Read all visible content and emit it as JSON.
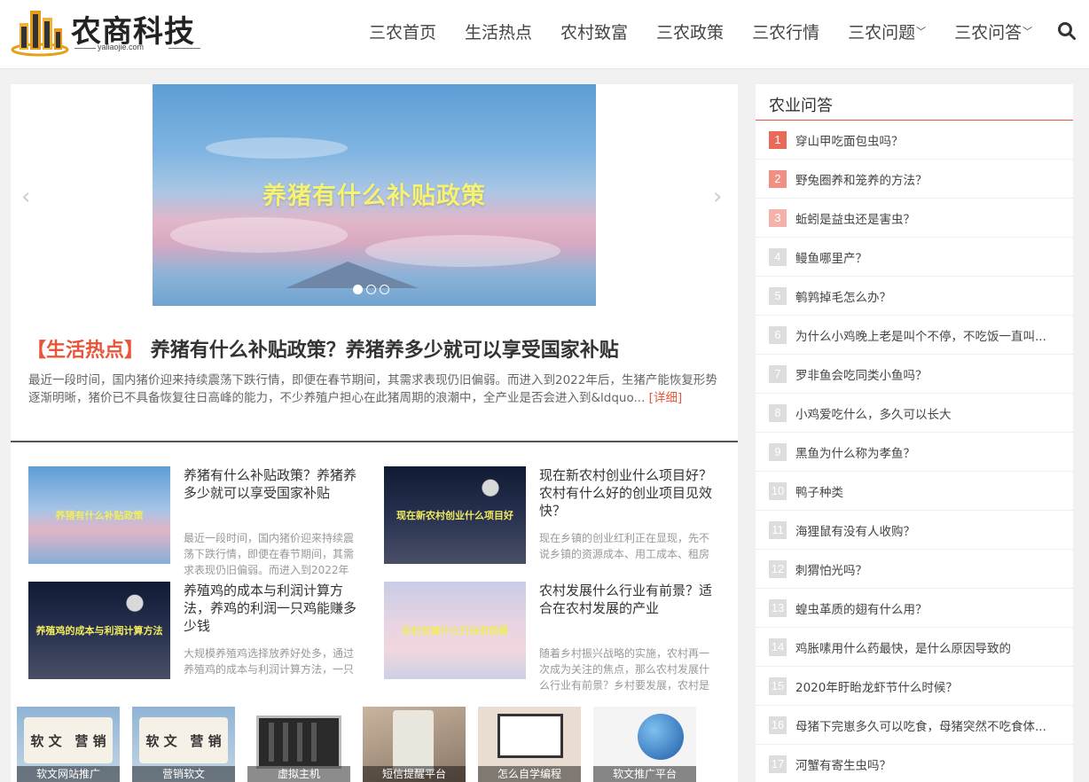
{
  "brand": {
    "name": "农商科技",
    "domain": "yaliaojie.com"
  },
  "nav": {
    "items": [
      {
        "label": "三农首页",
        "dropdown": false
      },
      {
        "label": "生活热点",
        "dropdown": false
      },
      {
        "label": "农村致富",
        "dropdown": false
      },
      {
        "label": "三农政策",
        "dropdown": false
      },
      {
        "label": "三农行情",
        "dropdown": false
      },
      {
        "label": "三农问题",
        "dropdown": true
      },
      {
        "label": "三农问答",
        "dropdown": true
      }
    ],
    "search_icon": "search-icon"
  },
  "slider": {
    "caption": "养猪有什么补贴政策",
    "slide_count": 3,
    "active_slide": 1
  },
  "feature": {
    "category": "【生活热点】",
    "title": "养猪有什么补贴政策？养猪养多少就可以享受国家补贴",
    "excerpt": "最近一段时间，国内猪价迎来持续震荡下跌行情，即便在春节期间，其需求表现仍旧偏弱。而进入到2022年后，生猪产能恢复形势逐渐明晰，猪价已不具备恢复往日高峰的能力，不少养殖户担心在此猪周期的浪潮中，全产业是否会进入到&ldquo...",
    "more": "[详细]"
  },
  "posts": [
    {
      "thumb_text": "养猪有什么补贴政策",
      "title": "养猪有什么补贴政策？养猪养多少就可以享受国家补贴",
      "excerpt": "最近一段时间，国内猪价迎来持续震荡下跌行情，即便在春节期间，其需求表现仍旧偏弱。而进入到2022年"
    },
    {
      "thumb_text": "现在新农村创业什么项目好",
      "title": "现在新农村创业什么项目好？农村有什么好的创业项目见效快？",
      "excerpt": "现在乡镇的创业红利正在显现，先不说乡镇的资源成本、用工成本、租房"
    },
    {
      "thumb_text": "养殖鸡的成本与利润计算方法",
      "title": "养殖鸡的成本与利润计算方法，养鸡的利润一只鸡能赚多少钱",
      "excerpt": "大规模养殖鸡选择放养好处多，通过养殖鸡的成本与利润计算方法，一只"
    },
    {
      "thumb_text": "农村发展什么行业有前景",
      "title": "农村发展什么行业有前景？适合在农村发展的产业",
      "excerpt": "随着乡村振兴战略的实施，农村再一次成为关注的焦点，那么农村发展什么行业有前景？乡村要发展，农村是"
    }
  ],
  "ads": [
    {
      "label": "软文网站推广",
      "book_text": [
        "软 文",
        "营 销"
      ]
    },
    {
      "label": "营销软文",
      "book_text": [
        "软 文",
        "营 销"
      ]
    },
    {
      "label": "虚拟主机"
    },
    {
      "label": "短信提醒平台"
    },
    {
      "label": "怎么自学编程"
    },
    {
      "label": "软文推广平台"
    }
  ],
  "sidebar": {
    "title": "农业问答",
    "items": [
      "穿山甲吃面包虫吗？",
      "野兔圈养和笼养的方法？",
      "蚯蚓是益虫还是害虫？",
      "鳗鱼哪里产？",
      "鹌鹑掉毛怎么办？",
      "为什么小鸡晚上老是叫个不停，不吃饭一直叫...",
      "罗非鱼会吃同类小鱼吗？",
      "小鸡爱吃什么，多久可以长大",
      "黑鱼为什么称为孝鱼？",
      "鸭子种类",
      "海狸鼠有没有人收购？",
      "刺猬怕光吗？",
      "蝗虫革质的翅有什么用？",
      "鸡胀嗉用什么药最快，是什么原因导致的",
      "2020年盱眙龙虾节什么时候？",
      "母猪下完崽多久可以吃食，母猪突然不吃食体...",
      "河蟹有寄生虫吗？"
    ]
  }
}
